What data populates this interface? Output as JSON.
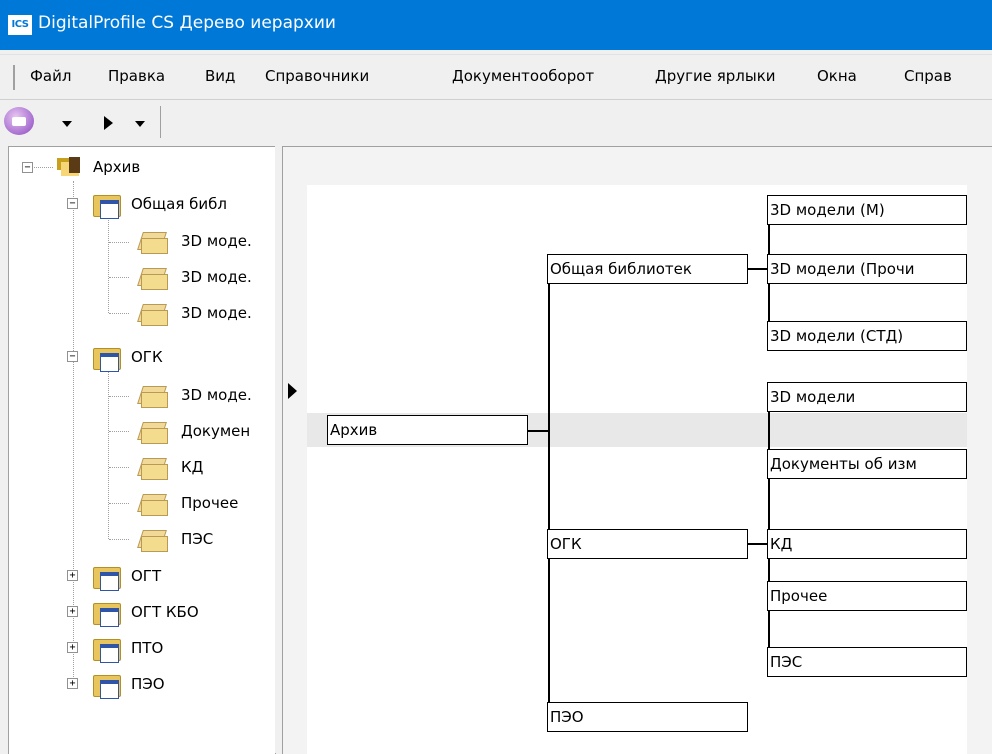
{
  "window": {
    "title": "DigitalProfile CS Дерево иерархии",
    "logo": "ICS"
  },
  "menu": {
    "items": [
      "Файл",
      "Правка",
      "Вид",
      "Справочники",
      "Документооборот",
      "Другие ярлыки",
      "Окна",
      "Справ"
    ]
  },
  "toolbar": {
    "icons": [
      "print-icon",
      "dropdown-caret-icon",
      "play-icon",
      "dropdown-caret-icon"
    ]
  },
  "tree": {
    "root": "Архив",
    "groups": [
      {
        "label": "Общая библ",
        "expanded": true,
        "children": [
          "3D моде.",
          "3D моде.",
          "3D моде."
        ]
      },
      {
        "label": "ОГК",
        "expanded": true,
        "children": [
          "3D моде.",
          "Докумен",
          "КД",
          "Прочее",
          "ПЭС"
        ]
      },
      {
        "label": "ОГТ",
        "expanded": false
      },
      {
        "label": "ОГТ КБО",
        "expanded": false
      },
      {
        "label": "ПТО",
        "expanded": false
      },
      {
        "label": "ПЭО",
        "expanded": false
      }
    ],
    "expander_plus": "+",
    "expander_minus": "−"
  },
  "diagram": {
    "root": "Архив",
    "groups": [
      {
        "label": "Общая библиотек",
        "children": [
          "3D модели (М)",
          "3D модели (Прочи",
          "3D модели (СТД)"
        ]
      },
      {
        "label": "ОГК",
        "children": [
          "3D модели",
          "Документы об изм",
          "КД",
          "Прочее",
          "ПЭС"
        ]
      },
      {
        "label": "ПЭО",
        "children": []
      }
    ]
  }
}
